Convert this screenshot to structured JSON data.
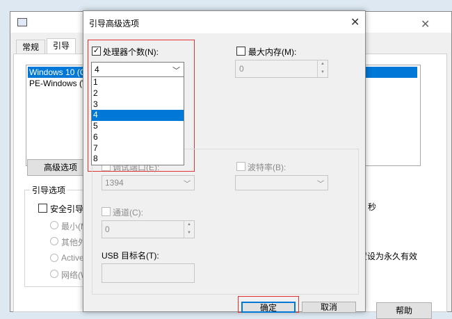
{
  "background_window": {
    "tabs": [
      "常规",
      "引导"
    ],
    "os_list": [
      "Windows 10 (C",
      "PE-Windows (W"
    ],
    "advanced_button": "高级选项",
    "boot_options_legend": "引导选项",
    "safe_boot_label": "安全引导(",
    "radio_options": [
      "最小(M",
      "其他外",
      "Active",
      "网络(W"
    ],
    "seconds_label": "秒",
    "persistent_label": "置设为永久有效",
    "help_button": "帮助",
    "close_glyph": "✕"
  },
  "dialog": {
    "title": "引导高级选项",
    "close_glyph": "✕",
    "processors": {
      "label": "处理器个数(N):",
      "checked": true,
      "selected_value": "4",
      "options": [
        "1",
        "2",
        "3",
        "4",
        "5",
        "6",
        "7",
        "8"
      ]
    },
    "max_memory": {
      "label": "最大内存(M):",
      "checked": false,
      "value": "0"
    },
    "debug_port": {
      "label": "调试端口(E):",
      "value": "1394"
    },
    "baud_rate": {
      "label": "波特率(B):",
      "value": ""
    },
    "channel": {
      "label": "通道(C):",
      "value": "0"
    },
    "usb_target": {
      "label": "USB 目标名(T):",
      "value": ""
    },
    "ok_button": "确定",
    "cancel_button": "取消"
  },
  "colors": {
    "selection_blue": "#0078d7",
    "highlight_red": "#e03030"
  }
}
